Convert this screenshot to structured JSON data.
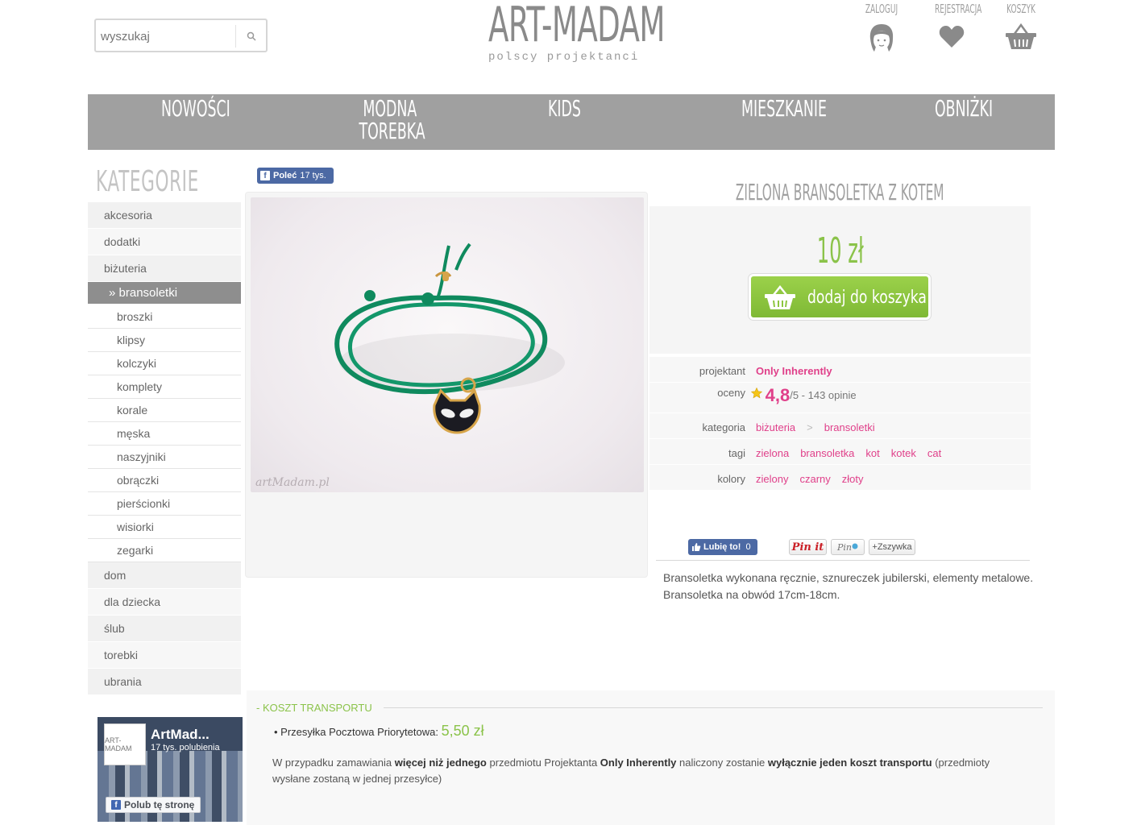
{
  "header": {
    "search_placeholder": "wyszukaj",
    "logo_title": "ART-MADAM",
    "logo_subtitle": "polscy projektanci",
    "links": [
      {
        "label": "ZALOGUJ",
        "icon": "avatar-icon"
      },
      {
        "label": "REJESTRACJA",
        "icon": "heart-icon"
      },
      {
        "label": "KOSZYK",
        "icon": "basket-icon"
      }
    ]
  },
  "nav": {
    "items": [
      {
        "label": "NOWOŚCI"
      },
      {
        "label": "MODNA\n TOREBKA"
      },
      {
        "label": "KIDS"
      },
      {
        "label": "MIESZKANIE"
      },
      {
        "label": "OBNIŻKI"
      }
    ]
  },
  "sidebar": {
    "title": "KATEGORIE",
    "categories": [
      {
        "label": "akcesoria"
      },
      {
        "label": "dodatki"
      },
      {
        "label": "biżuteria"
      },
      {
        "label": "» bransoletki"
      },
      {
        "label": "broszki"
      },
      {
        "label": "klipsy"
      },
      {
        "label": "kolczyki"
      },
      {
        "label": "komplety"
      },
      {
        "label": "korale"
      },
      {
        "label": "męska"
      },
      {
        "label": "naszyjniki"
      },
      {
        "label": "obrączki"
      },
      {
        "label": "pierścionki"
      },
      {
        "label": "wisiorki"
      },
      {
        "label": "zegarki"
      },
      {
        "label": "dom"
      },
      {
        "label": "dla dziecka"
      },
      {
        "label": "ślub"
      },
      {
        "label": "torebki"
      },
      {
        "label": "ubrania"
      }
    ],
    "fb_widget": {
      "logo": "ART-MADAM",
      "name": "ArtMad...",
      "likes": "17 tys. polubienia",
      "like_button": "Polub tę stronę"
    }
  },
  "product": {
    "share_label": "Poleć",
    "share_count": "17 tys.",
    "watermark": "artMadam.pl",
    "title": "ZIELONA BRANSOLETKA Z KOTEM",
    "price": "10 zł",
    "add_to_cart": "dodaj do koszyka",
    "attributes": {
      "designer_label": "projektant",
      "designer": "Only Inherently",
      "rating_label": "oceny",
      "rating": "4,8",
      "rating_rest": "/5 - 143 opinie",
      "category_label": "kategoria",
      "category_1": "biżuteria",
      "category_sep": ">",
      "category_2": "bransoletki",
      "tags_label": "tagi",
      "tags": [
        "zielona",
        "bransoletka",
        "kot",
        "kotek",
        "cat"
      ],
      "colors_label": "kolory",
      "colors": [
        "zielony",
        "czarny",
        "złoty"
      ]
    },
    "social": {
      "fb_like": "Lubię to!",
      "fb_like_count": "0",
      "pinit": "Pin it",
      "fancy": "+Zszywka"
    },
    "description": "Bransoletka wykonana ręcznie, sznureczek jubilerski, elementy metalowe. Bransoletka na obwód 17cm-18cm."
  },
  "shipping": {
    "title": "KOSZT TRANSPORTU",
    "option": "• Przesyłka Pocztowa Priorytetowa:",
    "price": "5,50 zł",
    "note_1": "W przypadku zamawiania ",
    "note_b1": "więcej niż jednego",
    "note_2": " przedmiotu Projektanta ",
    "note_b2": "Only Inherently",
    "note_3": " naliczony zostanie ",
    "note_b3": "wyłącznie jeden koszt transportu",
    "note_4": " (przedmioty wysłane zostaną w jednej przesyłce)"
  },
  "colors": {
    "accent_green": "#8bc34a",
    "link_pink": "#e0408a",
    "nav_grey": "#a0a0a0"
  }
}
